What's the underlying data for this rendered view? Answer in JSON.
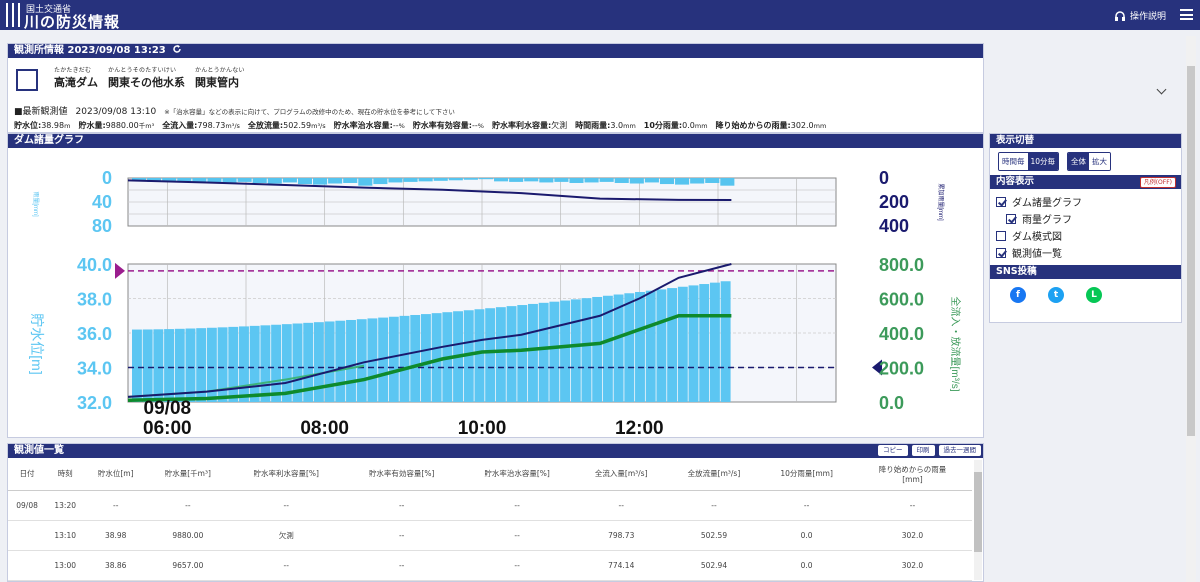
{
  "app": {
    "ministry": "国土交通省",
    "title": "川の防災情報",
    "help": "操作説明"
  },
  "info": {
    "header": "観測所情報 2023/09/08 13:23",
    "ruby": [
      {
        "rt": "たかたきだむ",
        "rb": "高滝ダム"
      },
      {
        "rt": "かんとうそのたすいけい",
        "rb": "関東その他水系"
      },
      {
        "rt": "かんとうかんない",
        "rb": "関東管内"
      }
    ],
    "latest_label": "■最新観測値",
    "latest_time": "2023/09/08 13:10",
    "note": "※「治水容量」などの表示に向けて、プログラムの改修中のため、現在の貯水位を参考にして下さい",
    "stats": [
      {
        "label": "貯水位:",
        "value": "38.98",
        "unit": "m"
      },
      {
        "label": "貯水量:",
        "value": "9880.00",
        "unit": "千m³"
      },
      {
        "label": "全流入量:",
        "value": "798.73",
        "unit": "m³/s"
      },
      {
        "label": "全放流量:",
        "value": "502.59",
        "unit": "m³/s"
      },
      {
        "label": "貯水率治水容量:",
        "value": "--",
        "unit": "%"
      },
      {
        "label": "貯水率有効容量:",
        "value": "--",
        "unit": "%"
      },
      {
        "label": "貯水率利水容量:",
        "value": "欠測",
        "unit": ""
      },
      {
        "label": "時間雨量:",
        "value": "3.0",
        "unit": "mm"
      },
      {
        "label": "10分雨量:",
        "value": "0.0",
        "unit": "mm"
      },
      {
        "label": "降り始めからの雨量:",
        "value": "302.0",
        "unit": "mm"
      }
    ]
  },
  "chart": {
    "header": "ダム諸量グラフ",
    "rain_axis_label": "雨量[mm]",
    "cum_axis_label": "累加雨量[mm]",
    "level_axis_label": "貯水位[m]",
    "flow_axis_label": "全流入・放流量[m³/s]"
  },
  "chart_data": {
    "type": "bar",
    "x_ticks": [
      "09/08\n06:00",
      "08:00",
      "10:00",
      "12:00"
    ],
    "rain_ticks": [
      "0",
      "40",
      "80"
    ],
    "cum_rain_ticks": [
      "0",
      "200",
      "400"
    ],
    "level_ticks": [
      "40.0",
      "38.0",
      "36.0",
      "34.0",
      "32.0"
    ],
    "flow_ticks": [
      "800.0",
      "600.0",
      "400.0",
      "200.0",
      "0.0"
    ],
    "rain_ylim": [
      0,
      80
    ],
    "cum_ylim": [
      0,
      400
    ],
    "level_ylim": [
      32,
      40
    ],
    "flow_ylim": [
      0,
      800
    ],
    "x_start_hour": 5.5,
    "x_end_hour": 14.5,
    "storage_level": {
      "hours": [
        5.5,
        13.17
      ],
      "start": 36.2,
      "end": 39.0
    },
    "cumulative_rain": {
      "hours": [
        5.5,
        6.5,
        7.5,
        8.5,
        9.5,
        10.5,
        11.5,
        12.5,
        13.17
      ],
      "values": [
        20,
        38,
        58,
        80,
        98,
        126,
        172,
        182,
        183
      ]
    },
    "inflow": {
      "hours": [
        5.5,
        6.5,
        7.5,
        8.5,
        9.5,
        10.0,
        10.5,
        11.5,
        12.0,
        12.5,
        13.17
      ],
      "values": [
        30,
        60,
        110,
        230,
        320,
        360,
        390,
        500,
        600,
        720,
        800
      ]
    },
    "outflow": {
      "hours": [
        5.5,
        6.5,
        7.5,
        8.5,
        9.0,
        9.5,
        10.0,
        10.5,
        11.5,
        12.0,
        12.5,
        13.17
      ],
      "values": [
        10,
        20,
        50,
        130,
        190,
        250,
        290,
        300,
        340,
        420,
        500,
        500
      ]
    },
    "outflow_early": {
      "hours": [
        5.5,
        6.5,
        7.5,
        8.5
      ],
      "values": [
        30,
        60,
        130,
        210
      ]
    },
    "rain_bars_hourly": [
      6,
      5,
      6,
      7,
      8,
      6,
      9,
      8
    ],
    "rain_bars_10min": [
      4,
      5,
      4,
      6,
      5,
      7,
      6,
      5,
      7,
      8,
      6,
      9,
      10,
      8,
      7,
      12,
      9,
      6,
      5,
      4,
      3,
      2,
      1,
      0
    ],
    "reference_lines": {
      "max_level": 39.6,
      "flood_flow": 200
    }
  },
  "side": {
    "display_header": "表示切替",
    "seg1": [
      "時間毎",
      "10分毎"
    ],
    "seg2": [
      "全体",
      "拡大"
    ],
    "content_header": "内容表示",
    "legend_btn": "凡例(OFF)",
    "checks": [
      {
        "label": "ダム諸量グラフ",
        "checked": true,
        "indent": false
      },
      {
        "label": "雨量グラフ",
        "checked": true,
        "indent": true
      },
      {
        "label": "ダム模式図",
        "checked": false,
        "indent": false
      },
      {
        "label": "観測値一覧",
        "checked": true,
        "indent": false
      }
    ],
    "sns_header": "SNS投稿",
    "sns": [
      "f",
      "t",
      "L"
    ],
    "colors": {
      "facebook": "#1877f2",
      "twitter": "#1da1f2",
      "line": "#06c755"
    }
  },
  "table": {
    "header": "観測値一覧",
    "buttons": [
      "コピー",
      "印刷",
      "過去一週間"
    ],
    "columns": [
      "日付",
      "時刻",
      "貯水位[m]",
      "貯水量[千m³]",
      "貯水率利水容量[%]",
      "貯水率有効容量[%]",
      "貯水率治水容量[%]",
      "全流入量[m³/s]",
      "全放流量[m³/s]",
      "10分雨量[mm]",
      "降り始めからの雨量\n[mm]"
    ],
    "rows": [
      [
        "09/08",
        "13:20",
        "--",
        "--",
        "--",
        "--",
        "--",
        "--",
        "--",
        "--",
        "--"
      ],
      [
        "",
        "13:10",
        "38.98",
        "9880.00",
        "欠測",
        "--",
        "--",
        "798.73",
        "502.59",
        "0.0",
        "302.0"
      ],
      [
        "",
        "13:00",
        "38.86",
        "9657.00",
        "--",
        "--",
        "--",
        "774.14",
        "502.94",
        "0.0",
        "302.0"
      ]
    ]
  }
}
